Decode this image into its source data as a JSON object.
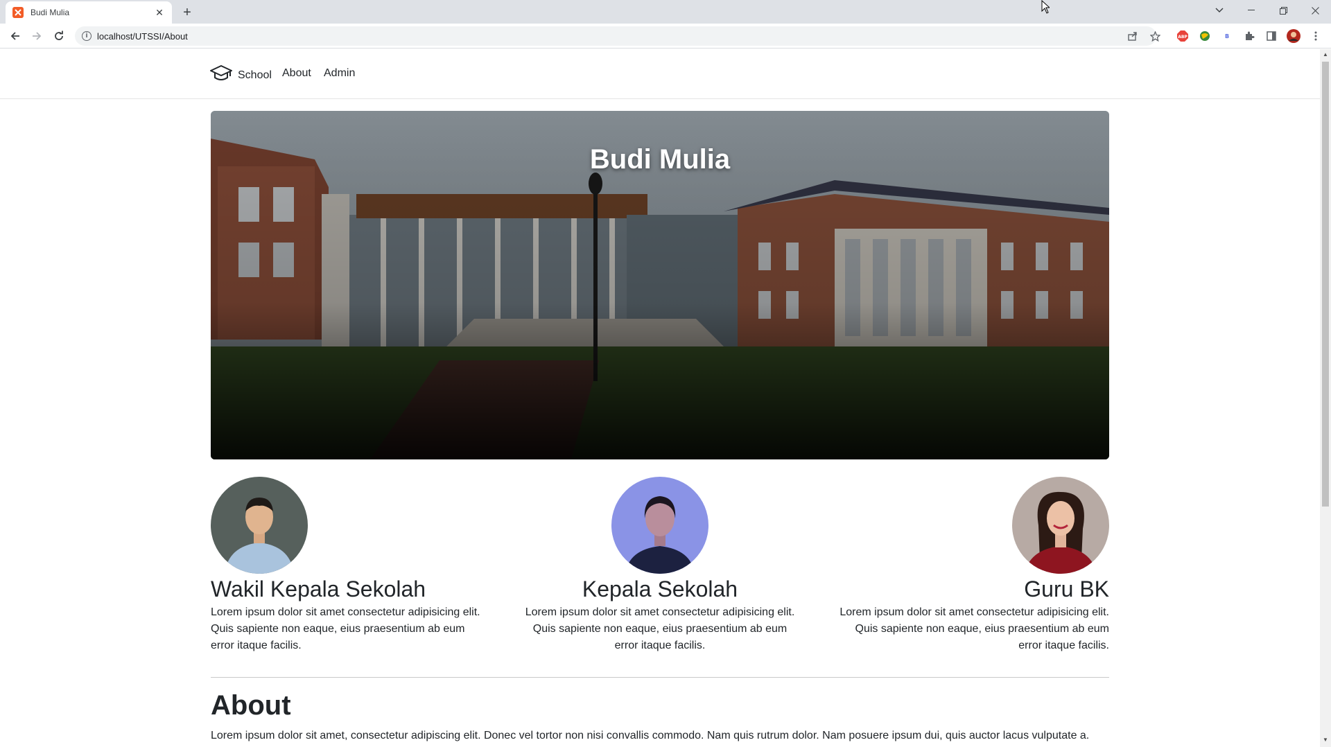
{
  "browser": {
    "tab_title": "Budi Mulia",
    "url": "localhost/UTSSI/About"
  },
  "navbar": {
    "brand": "School",
    "links": [
      "About",
      "Admin"
    ]
  },
  "hero": {
    "title": "Budi Mulia"
  },
  "staff": [
    {
      "role": "Wakil Kepala Sekolah",
      "desc": "Lorem ipsum dolor sit amet consectetur adipisicing elit. Quis sapiente non eaque, eius praesentium ab eum error itaque facilis."
    },
    {
      "role": "Kepala Sekolah",
      "desc": "Lorem ipsum dolor sit amet consectetur adipisicing elit. Quis sapiente non eaque, eius praesentium ab eum error itaque facilis."
    },
    {
      "role": "Guru BK",
      "desc": "Lorem ipsum dolor sit amet consectetur adipisicing elit. Quis sapiente non eaque, eius praesentium ab eum error itaque facilis."
    }
  ],
  "about": {
    "title": "About",
    "text": "Lorem ipsum dolor sit amet, consectetur adipiscing elit. Donec vel tortor non nisi convallis commodo. Nam quis rutrum dolor. Nam posuere ipsum dui, quis auctor lacus vulputate a."
  },
  "colors": {
    "favicon": "#f25c27",
    "chrome_bg": "#dee1e6",
    "text": "#212529"
  }
}
